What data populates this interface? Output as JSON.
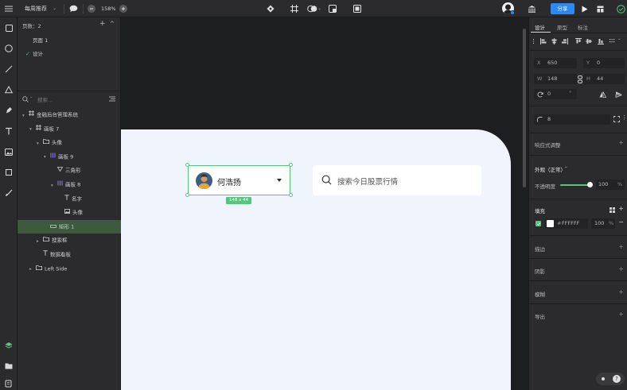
{
  "topbar": {
    "title": "每周推荐",
    "zoom": "158%",
    "share": "分享"
  },
  "layers": {
    "page_count": "页数：2",
    "pages": [
      {
        "label": "页面 1",
        "checked": false
      },
      {
        "label": "设计",
        "checked": true
      }
    ],
    "search_placeholder": "搜索...",
    "tree": [
      {
        "label": "金融后台管理系统",
        "indent": 0,
        "icon": "frame",
        "chev": "▾"
      },
      {
        "label": "画板 7",
        "indent": 1,
        "icon": "frame",
        "chev": "▾"
      },
      {
        "label": "头像",
        "indent": 2,
        "icon": "folder",
        "chev": "▾"
      },
      {
        "label": "画板 9",
        "indent": 3,
        "icon": "grid",
        "chev": "▾"
      },
      {
        "label": "三角形",
        "indent": 4,
        "icon": "triangle",
        "chev": ""
      },
      {
        "label": "画板 8",
        "indent": 4,
        "icon": "grid",
        "chev": "▾"
      },
      {
        "label": "名字",
        "indent": 5,
        "icon": "text",
        "chev": ""
      },
      {
        "label": "头像",
        "indent": 5,
        "icon": "image",
        "chev": ""
      },
      {
        "label": "矩形 1",
        "indent": 3,
        "icon": "rect",
        "chev": "",
        "selected": true
      },
      {
        "label": "搜索框",
        "indent": 2,
        "icon": "folder",
        "chev": "▸"
      },
      {
        "label": "数据看板",
        "indent": 2,
        "icon": "text",
        "chev": ""
      },
      {
        "label": "Left Side",
        "indent": 1,
        "icon": "folder",
        "chev": "▸"
      }
    ]
  },
  "canvas": {
    "user_name": "何浩扬",
    "size_label": "148 x 44",
    "search_placeholder": "搜索今日股票行情"
  },
  "props": {
    "tabs": [
      "设计",
      "原型",
      "标注"
    ],
    "x": "650",
    "y": "0",
    "w": "148",
    "h": "44",
    "rotation": "0",
    "degree": "°",
    "radius": "8",
    "label_x": "X",
    "label_y": "Y",
    "label_w": "W",
    "label_h": "H",
    "adaptive": "响应式调整",
    "appearance": "外观（正常）",
    "opacity_label": "不透明度",
    "opacity": "100",
    "opacity_unit": "%",
    "fill_title": "填充",
    "fill_hex": "FFFFFF",
    "fill_opacity": "100",
    "fill_unit": "%",
    "stroke": "描边",
    "shadow": "阴影",
    "blur": "模糊",
    "export": "导出"
  },
  "colors": {
    "accent": "#2d88f0",
    "selection": "#58c47e",
    "artboard": "#f0f5fd"
  }
}
